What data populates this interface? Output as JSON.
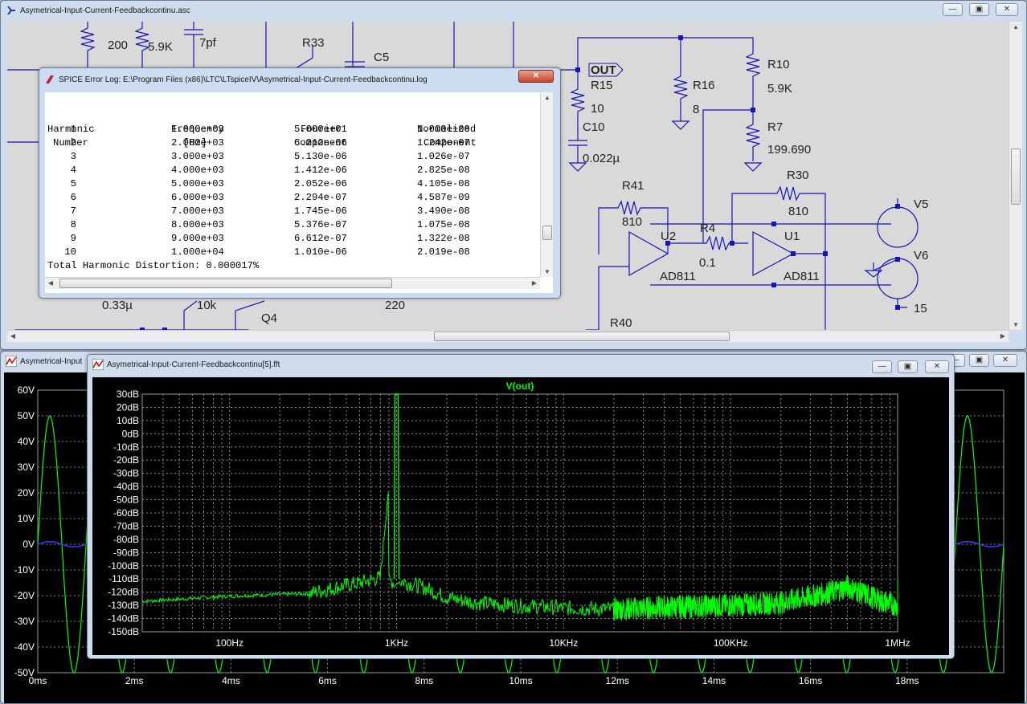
{
  "schematic_window": {
    "title": "Asymetrical-Input-Current-Feedbackcontinu.asc",
    "labels": {
      "r_top_left": "200",
      "r_top_left2": "5.9K",
      "cap_7pf": "7pf",
      "r33": "R33",
      "c5": "C5",
      "out": "OUT",
      "r15": "R15",
      "r15_val": "10",
      "c10": "C10",
      "c10_val": "0.022µ",
      "r16": "R16",
      "r16_val": "8",
      "r10": "R10",
      "r10_val": "5.9K",
      "r7": "R7",
      "r7_val": "199.690",
      "r41": "R41",
      "r41_val": "810",
      "r30": "R30",
      "r30_val": "810",
      "u2": "U2",
      "u1": "U1",
      "r4": "R4",
      "r4_val": "0.1",
      "ad811_a": "AD811",
      "ad811_b": "AD811",
      "v5": "V5",
      "v6": "V6",
      "v15": "15",
      "r40": "R40",
      "cap_033": "0.33µ",
      "r10k": "10k",
      "q4": "Q4",
      "r220": "220"
    }
  },
  "log_window": {
    "title": "SPICE Error Log: E:\\Program Files (x86)\\LTC\\LTspiceIV\\Asymetrical-Input-Current-Feedbackcontinu.log",
    "headers": [
      [
        "Harmonic",
        "Number"
      ],
      [
        "Frequency",
        "[Hz]"
      ],
      [
        "Fourier",
        "Component"
      ],
      [
        "Normalized",
        "Component"
      ]
    ],
    "rows": [
      [
        "1",
        "1.000e+03",
        "5.000e+01",
        "1.000e+00"
      ],
      [
        "2",
        "2.000e+03",
        "6.212e-06",
        "1.242e-07"
      ],
      [
        "3",
        "3.000e+03",
        "5.130e-06",
        "1.026e-07"
      ],
      [
        "4",
        "4.000e+03",
        "1.412e-06",
        "2.825e-08"
      ],
      [
        "5",
        "5.000e+03",
        "2.052e-06",
        "4.105e-08"
      ],
      [
        "6",
        "6.000e+03",
        "2.294e-07",
        "4.587e-09"
      ],
      [
        "7",
        "7.000e+03",
        "1.745e-06",
        "3.490e-08"
      ],
      [
        "8",
        "8.000e+03",
        "5.376e-07",
        "1.075e-08"
      ],
      [
        "9",
        "9.000e+03",
        "6.612e-07",
        "1.322e-08"
      ],
      [
        "10",
        "1.000e+04",
        "1.010e-06",
        "2.019e-08"
      ]
    ],
    "thd": "Total Harmonic Distortion: 0.000017%"
  },
  "wave_window": {
    "title": "Asymetrical-Input",
    "y_ticks": [
      "60V",
      "50V",
      "40V",
      "30V",
      "20V",
      "10V",
      "0V",
      "-10V",
      "-20V",
      "-30V",
      "-40V",
      "-50V"
    ],
    "x_ticks": [
      "0ms",
      "2ms",
      "4ms",
      "6ms",
      "8ms",
      "10ms",
      "12ms",
      "14ms",
      "16ms",
      "18ms"
    ]
  },
  "fft_window": {
    "title": "Asymetrical-Input-Current-Feedbackcontinu[5].fft",
    "trace_name": "V(out)",
    "y_ticks": [
      "30dB",
      "20dB",
      "10dB",
      "0dB",
      "-10dB",
      "-20dB",
      "-30dB",
      "-40dB",
      "-50dB",
      "-60dB",
      "-70dB",
      "-80dB",
      "-90dB",
      "-100dB",
      "-110dB",
      "-120dB",
      "-130dB",
      "-140dB",
      "-150dB"
    ],
    "x_ticks": [
      "100Hz",
      "1KHz",
      "10KHz",
      "100KHz",
      "1MHz"
    ]
  },
  "chart_data": [
    {
      "type": "line",
      "title": "V(out)",
      "xlabel": "",
      "ylabel": "",
      "x_scale": "log",
      "xlim": [
        30,
        1000000
      ],
      "ylim": [
        -150,
        30
      ],
      "x_unit": "Hz",
      "y_unit": "dB",
      "grid": true,
      "series": [
        {
          "color": "#00ff00",
          "x": [
            30,
            100,
            300,
            450,
            600,
            800,
            1000,
            1100,
            1500,
            2000,
            3000,
            5000,
            10000,
            20000,
            50000,
            100000,
            200000,
            400000,
            500000,
            650000,
            800000,
            1000000
          ],
          "y": [
            -127,
            -123,
            -121,
            -116,
            -113,
            -109,
            30,
            -112,
            -117,
            -124,
            -128,
            -130,
            -132,
            -133,
            -131,
            -130,
            -128,
            -120,
            -116,
            -122,
            -127,
            -130
          ]
        }
      ]
    },
    {
      "type": "line",
      "xlim": [
        0,
        20
      ],
      "ylim": [
        -50,
        60
      ],
      "x_unit": "ms",
      "y_unit": "V",
      "grid": true,
      "series": [
        {
          "color": "#00ff00",
          "shape": "sine",
          "amplitude": 50,
          "frequency_khz": 1
        },
        {
          "color": "#3a3aff",
          "shape": "sine",
          "amplitude": 1,
          "frequency_khz": 1
        }
      ]
    }
  ],
  "colors": {
    "trace_green": "#00ff00",
    "trace_blue": "#3a3aff",
    "wire": "#1616b4",
    "grid": "#8a8a8a"
  }
}
